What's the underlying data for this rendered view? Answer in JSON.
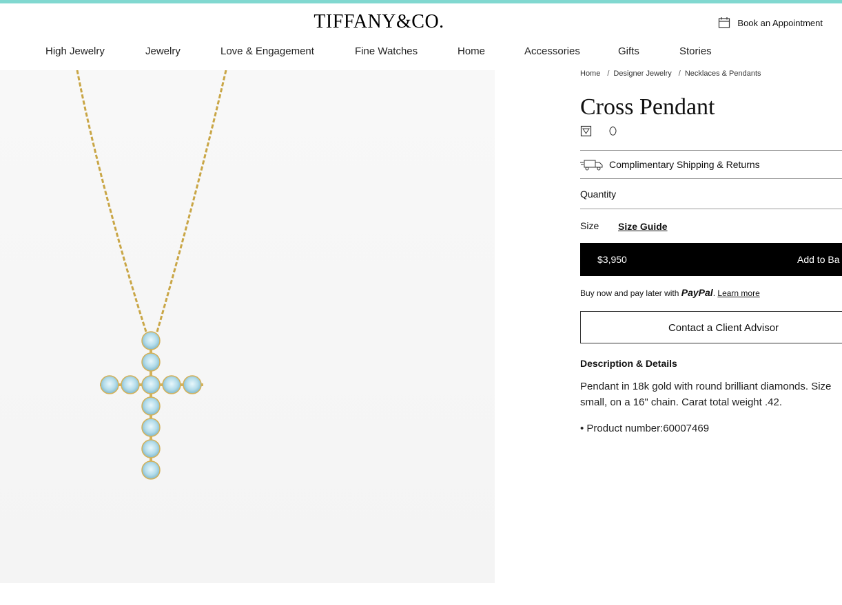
{
  "brand": {
    "logo": "TIFFANY&CO.",
    "accent_color": "#81d8d0"
  },
  "header": {
    "appointment_label": "Book an Appointment",
    "appointment_icon": "calendar-icon"
  },
  "nav": {
    "items": [
      "High Jewelry",
      "Jewelry",
      "Love & Engagement",
      "Fine Watches",
      "Home",
      "Accessories",
      "Gifts",
      "Stories"
    ]
  },
  "breadcrumb": [
    "Home",
    "Designer Jewelry",
    "Necklaces & Pendants"
  ],
  "product": {
    "title": "Cross Pendant",
    "icons": [
      "gift-box-icon",
      "gemstone-icon"
    ],
    "shipping_label": "Complimentary Shipping & Returns",
    "shipping_icon": "truck-icon",
    "quantity_label": "Quantity",
    "size_label": "Size",
    "size_guide_label": "Size Guide",
    "price": "$3,950",
    "add_to_bag_label": "Add to Ba",
    "paypal": {
      "prefix": "Buy now and pay later with",
      "brand": "PayPal",
      "suffix": ".",
      "learn_more": "Learn more"
    },
    "contact_label": "Contact a Client Advisor",
    "description_heading": "Description & Details",
    "description": "Pendant in 18k gold with round brilliant diamonds. Size small, on a 16\" chain. Carat total weight .42.",
    "product_number": "• Product number:60007469"
  }
}
